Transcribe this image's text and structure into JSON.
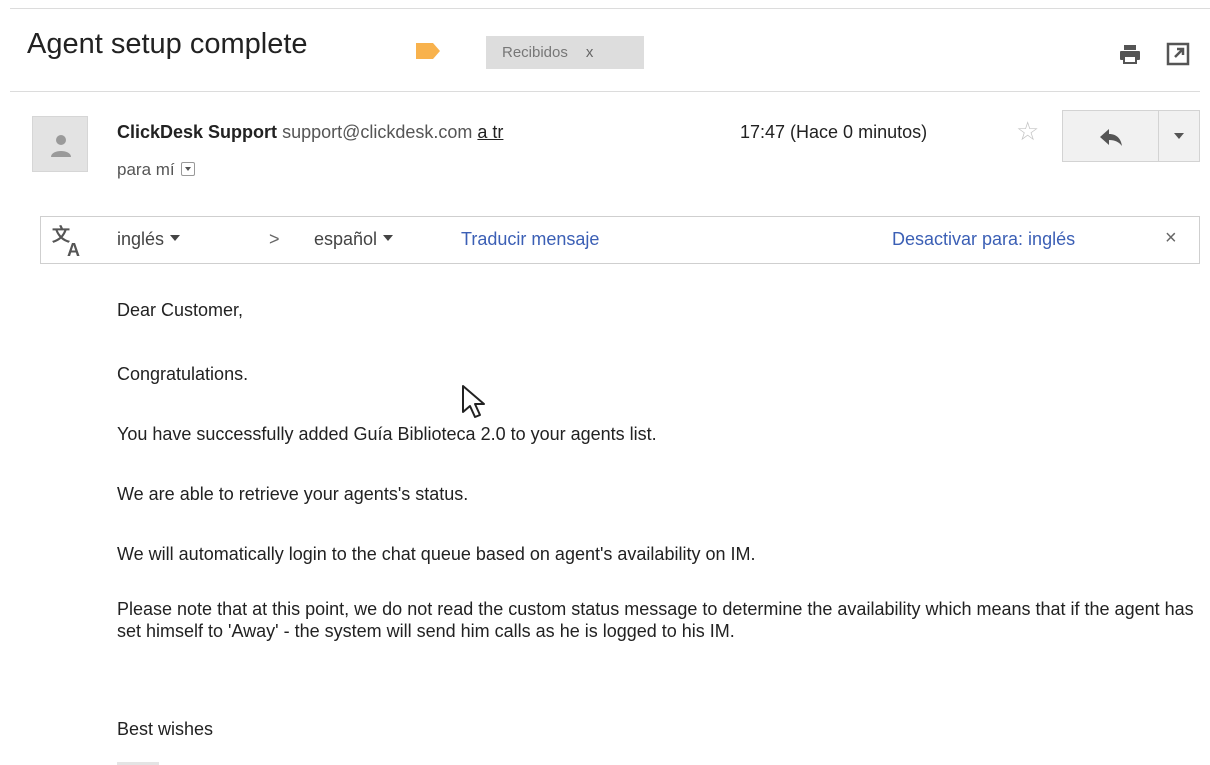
{
  "email": {
    "subject": "Agent setup complete",
    "label_chip": "Recibidos",
    "label_chip_close": "x",
    "sender_name": "ClickDesk Support",
    "sender_email": "support@clickdesk.com",
    "sender_link": "a tr",
    "to_text": "para mí",
    "timestamp": "17:47 (Hace 0 minutos)"
  },
  "translate_bar": {
    "from_lang": "inglés",
    "separator": ">",
    "to_lang": "español",
    "translate_link": "Traducir mensaje",
    "disable_link": "Desactivar para: inglés",
    "close": "×"
  },
  "body": {
    "paragraphs": [
      "Dear Customer,",
      "Congratulations.",
      "You have successfully added Guía Biblioteca 2.0 to your agents list.",
      "We are able to retrieve your agents's status.",
      "We will automatically login to the chat queue based on agent's availability on IM.",
      "Please note that at this point, we do not read the custom status message to determine the availability which means that if the agent has set himself to 'Away' - the system will send him calls as he is logged to his IM.",
      "Best wishes"
    ]
  },
  "icons": {
    "label": "label-tag-icon",
    "print": "printer-icon",
    "new_window": "new-window-icon",
    "avatar": "person-icon",
    "star": "star-outline-icon",
    "reply": "reply-arrow-icon",
    "more": "dropdown-arrow-icon",
    "translate": "translate-icon",
    "cursor": "mouse-pointer-icon"
  },
  "colors": {
    "label_orange": "#f8b24d",
    "link_blue": "#3b5fb5",
    "chip_gray": "#dddddd"
  }
}
